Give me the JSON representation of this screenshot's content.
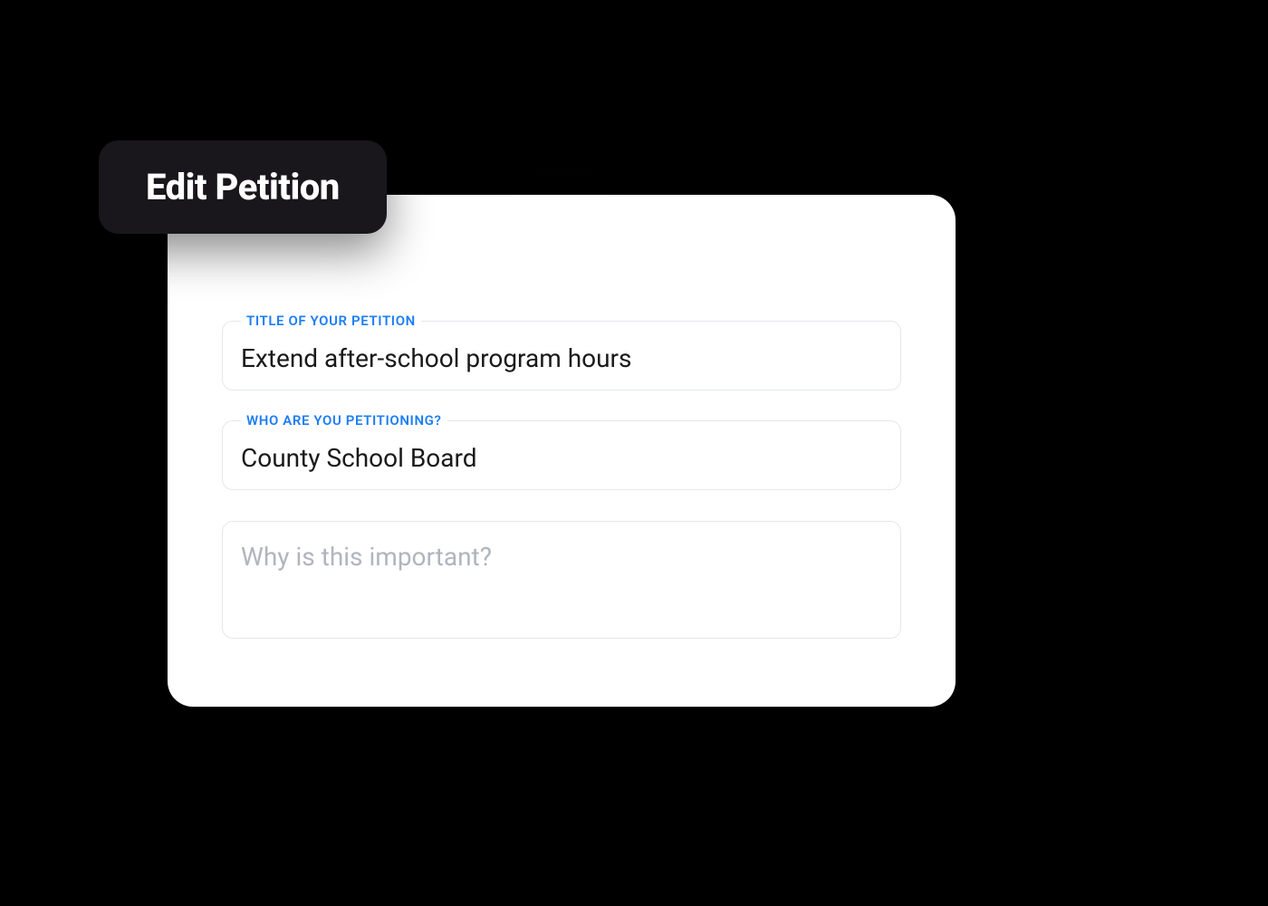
{
  "header": {
    "title": "Edit Petition"
  },
  "form": {
    "title_field": {
      "label": "TITLE OF YOUR PETITION",
      "value": "Extend after-school program hours"
    },
    "target_field": {
      "label": "WHO ARE YOU PETITIONING?",
      "value": "County School Board"
    },
    "reason_field": {
      "placeholder": "Why is this important?",
      "value": ""
    }
  },
  "colors": {
    "accent": "#1d7ef5",
    "badge_bg": "#19171c",
    "card_bg": "#ffffff",
    "border": "#e5e7eb",
    "placeholder": "#b0b5bd"
  }
}
